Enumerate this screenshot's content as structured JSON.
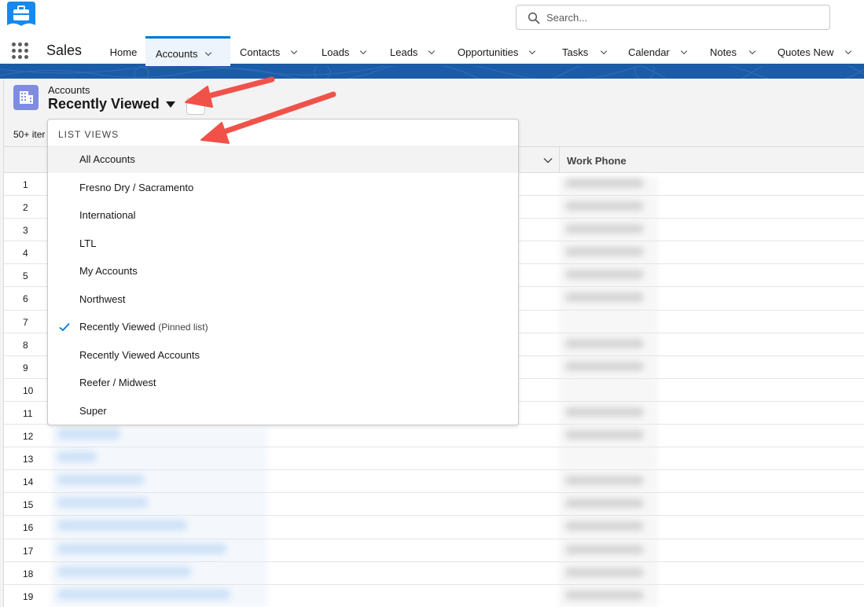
{
  "header": {
    "search_placeholder": "Search..."
  },
  "nav": {
    "app_name": "Sales",
    "items": [
      {
        "label": "Home"
      },
      {
        "label": "Accounts"
      },
      {
        "label": "Contacts"
      },
      {
        "label": "Loads"
      },
      {
        "label": "Leads"
      },
      {
        "label": "Opportunities"
      },
      {
        "label": "Tasks"
      },
      {
        "label": "Calendar"
      },
      {
        "label": "Notes"
      },
      {
        "label": "Quotes New"
      }
    ]
  },
  "list_header": {
    "object_label": "Accounts",
    "list_view_name": "Recently Viewed",
    "item_count": "50+ iter"
  },
  "table": {
    "columns": [
      "Work Phone"
    ],
    "row_numbers": [
      "1",
      "2",
      "3",
      "4",
      "5",
      "6",
      "7",
      "8",
      "9",
      "10",
      "11",
      "12",
      "13",
      "14",
      "15",
      "16",
      "17",
      "18",
      "19"
    ]
  },
  "list_views_menu": {
    "heading": "LIST VIEWS",
    "items": [
      {
        "label": "All Accounts",
        "sub": ""
      },
      {
        "label": "Fresno Dry / Sacramento",
        "sub": ""
      },
      {
        "label": "International",
        "sub": ""
      },
      {
        "label": "LTL",
        "sub": ""
      },
      {
        "label": "My Accounts",
        "sub": ""
      },
      {
        "label": "Northwest",
        "sub": ""
      },
      {
        "label": "Recently Viewed",
        "sub": "(Pinned list)"
      },
      {
        "label": "Recently Viewed Accounts",
        "sub": ""
      },
      {
        "label": "Reefer / Midwest",
        "sub": ""
      },
      {
        "label": "Super",
        "sub": ""
      }
    ],
    "selected": "Recently Viewed"
  },
  "colors": {
    "brand_blue": "#0176d3",
    "band_blue": "#1b5ca8",
    "annotation_arrow": "#f0524a",
    "object_icon": "#7f8de1"
  },
  "icons": [
    "app-logo-icon",
    "search-icon",
    "app-launcher-icon",
    "chevron-down-icon",
    "accounts-object-icon",
    "caret-down-icon",
    "checkmark-icon"
  ]
}
